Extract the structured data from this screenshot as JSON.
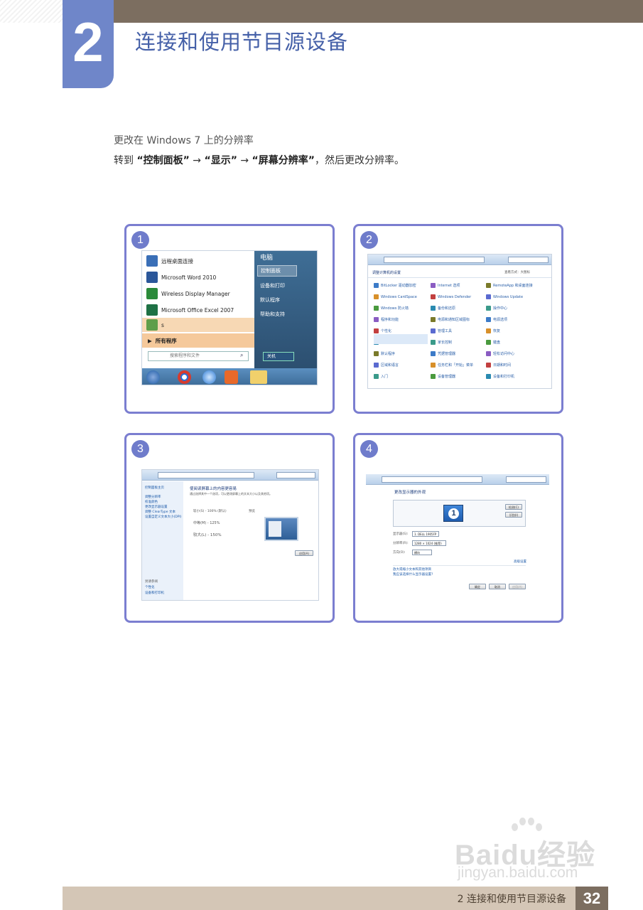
{
  "header": {
    "chapter_number": "2",
    "chapter_title": "连接和使用节目源设备"
  },
  "intro": {
    "line1": "更改在 Windows 7 上的分辨率",
    "line2_prefix": "转到 ",
    "step1": "“控制面板”",
    "arrow": " → ",
    "step2": "“显示”",
    "step3": "“屏幕分辨率”",
    "line2_suffix": "，然后更改分辨率。"
  },
  "panels": [
    {
      "badge": "1"
    },
    {
      "badge": "2"
    },
    {
      "badge": "3"
    },
    {
      "badge": "4"
    }
  ],
  "start_menu": {
    "items": [
      "远程桌面连接",
      "Microsoft Word 2010",
      "Wireless Display Manager",
      "Microsoft Office Excel 2007",
      "s"
    ],
    "all_programs": "所有程序",
    "search_placeholder": "搜索程序和文件",
    "right_items": [
      "电脑",
      "控制面板",
      "设备和打印",
      "默认程序",
      "帮助和支持"
    ],
    "shutdown": "关机"
  },
  "control_panel": {
    "header": "调整计算机的设置",
    "view": "查看方式：大图标",
    "col1": [
      "BitLocker 驱动器加密",
      "Windows CardSpace",
      "Windows 防火墙",
      "程序和功能",
      "个性化",
      "家庭组",
      "默认程序",
      "区域和语言",
      "入门"
    ],
    "col2": [
      "Internet 选项",
      "Windows Defender",
      "备份和还原",
      "电源和通知区域图标",
      "管理工具",
      "家长控制",
      "凭据管理器",
      "任务栏和「开始」菜单",
      "设备管理器"
    ],
    "col3": [
      "RemoteApp 和桌面连接",
      "Windows Update",
      "操作中心",
      "电源选项",
      "恢复",
      "键盘",
      "轻松访问中心",
      "日期和时间",
      "设备和打印机"
    ]
  },
  "display_window": {
    "side_links": [
      "控制面板主页",
      "调整分辨率",
      "校准颜色",
      "更改显示器设置",
      "调整 ClearType 文本",
      "设置自定义文本大小(DPI)"
    ],
    "see_also": [
      "另请参阅",
      "个性化",
      "设备和打印机"
    ],
    "title": "使阅读屏幕上的内容更容易",
    "desc": "通过选择其中一个选项，可以更改屏幕上的文本大小以及其他项。",
    "options": [
      "较小(S) - 100% (默认)",
      "中等(M) - 125%",
      "较大(L) - 150%"
    ],
    "preview_label": "预览",
    "apply": "应用(A)"
  },
  "resolution_window": {
    "title": "更改显示器的外观",
    "detect": "检测(C)",
    "identify": "识别(I)",
    "display_label": "显示器(S):",
    "display_value": "1. DELL 1905FP",
    "res_label": "分辨率(R):",
    "res_value": "1280 × 1024 (推荐)",
    "orient_label": "方向(O):",
    "orient_value": "横向",
    "advanced": "高级设置",
    "link1": "放大或缩小文本和其他项目",
    "link2": "我应该选择什么显示器设置?",
    "ok": "确定",
    "cancel": "取消",
    "apply": "应用(A)"
  },
  "footer": {
    "text": "2 连接和使用节目源设备",
    "page": "32"
  },
  "watermark": {
    "line1": "Baidu经验",
    "line2": "jingyan.baidu.com"
  }
}
